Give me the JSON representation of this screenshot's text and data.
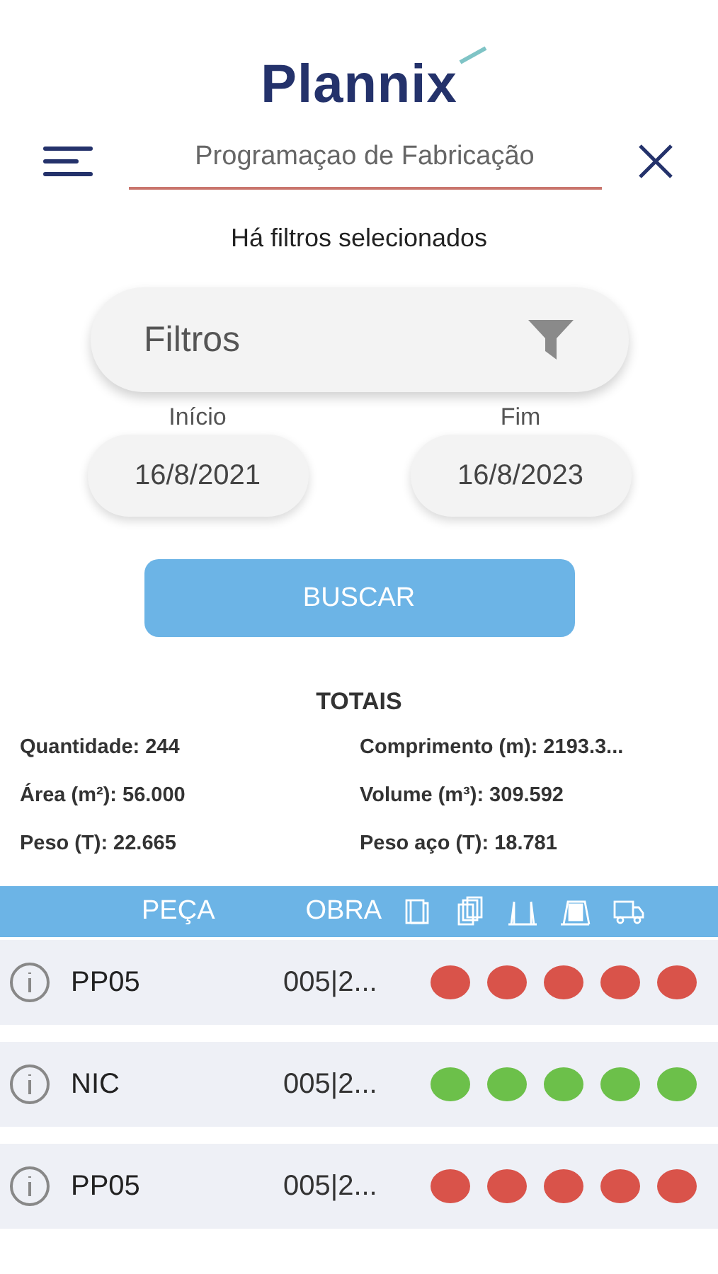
{
  "logo": "Plannix",
  "header": {
    "title": "Programaçao de Fabricação"
  },
  "filter_notice": "Há filtros selecionados",
  "filters": {
    "label": "Filtros"
  },
  "dates": [
    {
      "label": "Início",
      "value": "16/8/2021"
    },
    {
      "label": "Fim",
      "value": "16/8/2023"
    }
  ],
  "search_button": "BUSCAR",
  "totals": {
    "title": "TOTAIS",
    "items": [
      "Quantidade: 244",
      "Comprimento (m): 2193.3...",
      "Área (m²): 56.000",
      "Volume (m³): 309.592",
      "Peso (T): 22.665",
      "Peso aço (T): 18.781"
    ]
  },
  "table": {
    "columns": [
      "PEÇA",
      "OBRA"
    ],
    "rows": [
      {
        "peca": "PP05",
        "obra": "005|2...",
        "stages": [
          {
            "color": "#d9534a"
          },
          {
            "color": "#d9534a"
          },
          {
            "color": "#d9534a"
          },
          {
            "color": "#d9534a"
          },
          {
            "color": "#d9534a"
          }
        ]
      },
      {
        "peca": "NIC",
        "obra": "005|2...",
        "stages": [
          {
            "color": "#6cc04a"
          },
          {
            "color": "#6cc04a"
          },
          {
            "color": "#6cc04a"
          },
          {
            "color": "#6cc04a"
          },
          {
            "color": "#6cc04a"
          }
        ]
      },
      {
        "peca": "PP05",
        "obra": "005|2...",
        "stages": [
          {
            "color": "#d9534a"
          },
          {
            "color": "#d9534a"
          },
          {
            "color": "#d9534a"
          },
          {
            "color": "#d9534a"
          },
          {
            "color": "#d9534a"
          }
        ]
      }
    ]
  }
}
